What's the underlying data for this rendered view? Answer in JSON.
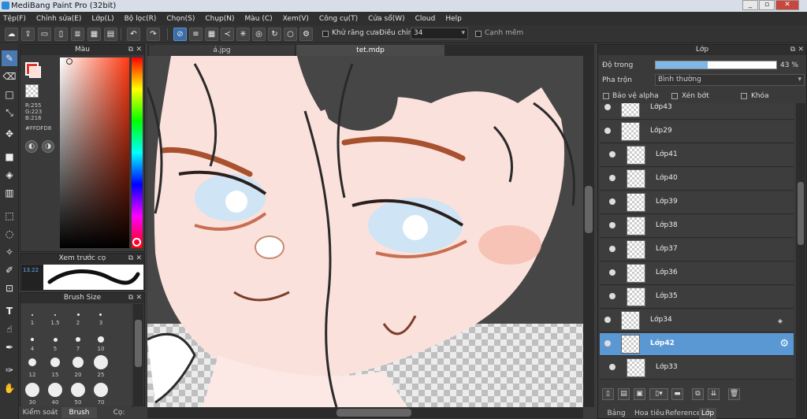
{
  "window": {
    "title": "MediBang Paint Pro (32bit)",
    "minimize": "_",
    "restore": "▫",
    "close": "✕"
  },
  "menu": [
    "Tệp(F)",
    "Chỉnh sửa(E)",
    "Lớp(L)",
    "Bộ lọc(R)",
    "Chọn(S)",
    "Chụp(N)",
    "Màu (C)",
    "Xem(V)",
    "Công cụ(T)",
    "Cửa sổ(W)",
    "Cloud",
    "Help"
  ],
  "toolbar": {
    "antialias_label": "Khử răng cưa",
    "strength_label": "Điều chỉnh",
    "strength_value": "34",
    "smooth_label": "Cạnh mềm"
  },
  "color_panel": {
    "title": "Màu",
    "r": "R:255",
    "g": "G:223",
    "b": "B:216",
    "hex": "#FFDFD8",
    "primary_color": "#FFDFD8"
  },
  "brush_preview": {
    "title": "Xem trước cọ",
    "label": "13.22"
  },
  "brush_size": {
    "title": "Brush Size",
    "sizes": [
      "1",
      "1.5",
      "2",
      "3",
      "4",
      "5",
      "7",
      "10",
      "12",
      "15",
      "20",
      "25",
      "30",
      "40",
      "50",
      "70"
    ]
  },
  "left_tabs": [
    "Kiểm soát cọ",
    "Brush Size",
    "Cọ: Airbrush"
  ],
  "canvas_tabs": [
    "á.jpg",
    "tet.mdp"
  ],
  "layers_panel": {
    "title": "Lớp",
    "opacity_label": "Độ trong",
    "opacity_percent": 43,
    "opacity_text": "43 %",
    "blend_label": "Pha trộn",
    "blend_value": "Bình thường",
    "protect_alpha": "Bảo vệ alpha",
    "clipping": "Xén bớt",
    "lock": "Khóa",
    "layers": [
      {
        "name": "Lớp43",
        "indented": false,
        "selected": false
      },
      {
        "name": "Lớp29",
        "indented": false,
        "selected": false
      },
      {
        "name": "Lớp41",
        "indented": true,
        "selected": false
      },
      {
        "name": "Lớp40",
        "indented": true,
        "selected": false
      },
      {
        "name": "Lớp39",
        "indented": true,
        "selected": false
      },
      {
        "name": "Lớp38",
        "indented": true,
        "selected": false
      },
      {
        "name": "Lớp37",
        "indented": true,
        "selected": false
      },
      {
        "name": "Lớp36",
        "indented": true,
        "selected": false
      },
      {
        "name": "Lớp35",
        "indented": true,
        "selected": false
      },
      {
        "name": "Lớp34",
        "indented": false,
        "selected": false
      },
      {
        "name": "Lớp42",
        "indented": false,
        "selected": true
      },
      {
        "name": "Lớp33",
        "indented": true,
        "selected": false
      }
    ]
  },
  "right_tabs": [
    "Bảng màu",
    "Hoa tiêu",
    "Reference",
    "Lớp"
  ]
}
